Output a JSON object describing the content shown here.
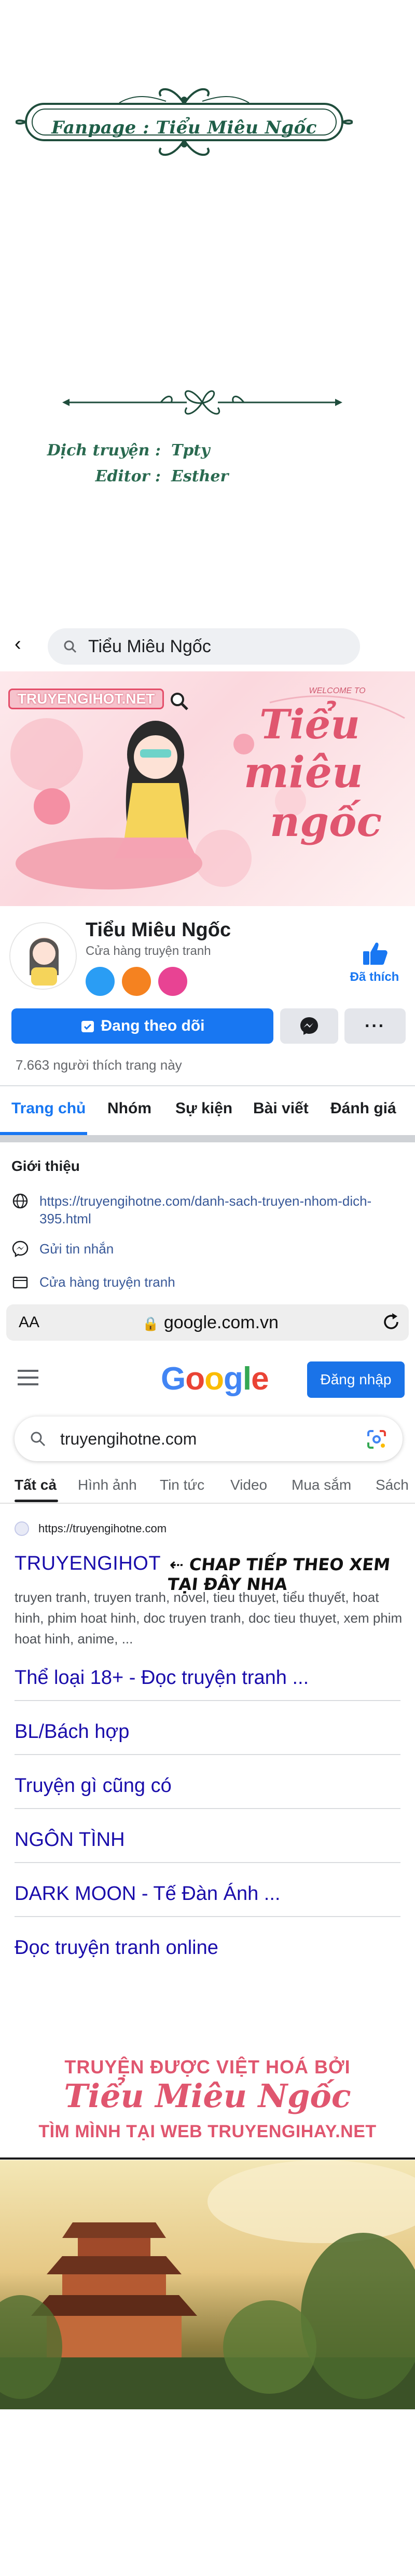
{
  "credits": {
    "fanpage": "Fanpage : Tiểu Miêu Ngốc",
    "translator_label": "Dịch truyện :",
    "translator_value": "Tpty",
    "editor_label": "Editor :",
    "editor_value": "Esther"
  },
  "facebook": {
    "search_value": "Tiểu Miêu Ngốc",
    "cover_logo": "TRUYENGIHOT.NET",
    "cover_welcome": "WELCOME TO",
    "cover_script_1": "Tiểu",
    "cover_script_2": "miêu",
    "cover_script_3": "ngốc",
    "page_name": "Tiểu Miêu Ngốc",
    "page_category": "Cửa hàng truyện tranh",
    "liked_label": "Đã thích",
    "follow_label": "Đang theo dõi",
    "more_label": "···",
    "likes_count": "7.663 người thích trang này",
    "tabs": [
      "Trang chủ",
      "Nhóm",
      "Sự kiện",
      "Bài viết",
      "Đánh giá"
    ],
    "intro_title": "Giới thiệu",
    "intro_link": "https://truyengihotne.com/danh-sach-truyen-nhom-dich-395.html",
    "intro_message": "Gửi tin nhắn",
    "intro_shop": "Cửa hàng truyện tranh",
    "accent": "#1877f2"
  },
  "browser": {
    "aa_label": "AA",
    "url": "google.com.vn"
  },
  "google": {
    "logo": [
      "G",
      "o",
      "o",
      "g",
      "l",
      "e"
    ],
    "logo_colors": [
      "#4285f4",
      "#ea4335",
      "#fbbc05",
      "#4285f4",
      "#34a853",
      "#ea4335"
    ],
    "signin_label": "Đăng nhập",
    "query": "truyengihotne.com",
    "tabs": [
      "Tất cả",
      "Hình ảnh",
      "Tin tức",
      "Video",
      "Mua sắm",
      "Sách"
    ],
    "result_site": "https://truyengihotne.com",
    "result_title": "TRUYENGIHOT",
    "handwritten_note": "⇠ CHAP TIẾP THEO XEM TẠI ĐÂY NHA",
    "snippet": "truyen tranh, truyen tranh, novel, tieu thuyet, tiểu thuyết, hoat hinh, phim hoat hinh, doc truyen tranh, doc tieu thuyet, xem phim hoat hinh, anime, ...",
    "sitelinks": [
      "Thể loại 18+ - Đọc truyện tranh ...",
      "BL/Bách hợp",
      "Truyện gì cũng có",
      "NGÔN TÌNH",
      "DARK MOON - Tế Đàn Ánh ...",
      "Đọc truyện tranh online"
    ]
  },
  "footer": {
    "line1": "TRUYỆN ĐƯỢC VIỆT HOÁ BỞI",
    "line2": "Tiểu Miêu Ngốc",
    "line3": "TÌM MÌNH TẠI WEB TRUYENGIHAY.NET",
    "color": "#e0566f"
  }
}
